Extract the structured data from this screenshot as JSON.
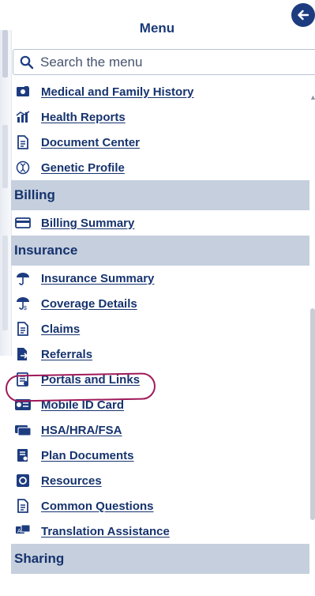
{
  "menu": {
    "title": "Menu",
    "search_placeholder": "Search the menu"
  },
  "items": [
    {
      "label": "Medical and Family History",
      "icon": "folder-icon",
      "type": "link"
    },
    {
      "label": "Health Reports",
      "icon": "bar-chart-icon",
      "type": "link"
    },
    {
      "label": "Document Center",
      "icon": "document-icon",
      "type": "link"
    },
    {
      "label": "Genetic Profile",
      "icon": "dna-icon",
      "type": "link"
    }
  ],
  "sections": {
    "billing": "Billing",
    "insurance": "Insurance",
    "sharing": "Sharing"
  },
  "billing_items": [
    {
      "label": "Billing Summary",
      "icon": "credit-card-icon"
    }
  ],
  "insurance_items": [
    {
      "label": "Insurance Summary",
      "icon": "umbrella-icon"
    },
    {
      "label": "Coverage Details",
      "icon": "umbrella-person-icon"
    },
    {
      "label": "Claims",
      "icon": "document-icon"
    },
    {
      "label": "Referrals",
      "icon": "document-arrow-icon"
    },
    {
      "label": "Portals and Links",
      "icon": "document-list-icon"
    },
    {
      "label": "Mobile ID Card",
      "icon": "id-card-icon"
    },
    {
      "label": "HSA/HRA/FSA",
      "icon": "cards-icon"
    },
    {
      "label": "Plan Documents",
      "icon": "plan-document-icon"
    },
    {
      "label": "Resources",
      "icon": "resources-icon"
    },
    {
      "label": "Common Questions",
      "icon": "question-document-icon"
    },
    {
      "label": "Translation Assistance",
      "icon": "translation-icon"
    }
  ],
  "colors": {
    "accent": "#16336e",
    "section_bg": "#c5cfdd",
    "annotation": "#a01a5a"
  }
}
